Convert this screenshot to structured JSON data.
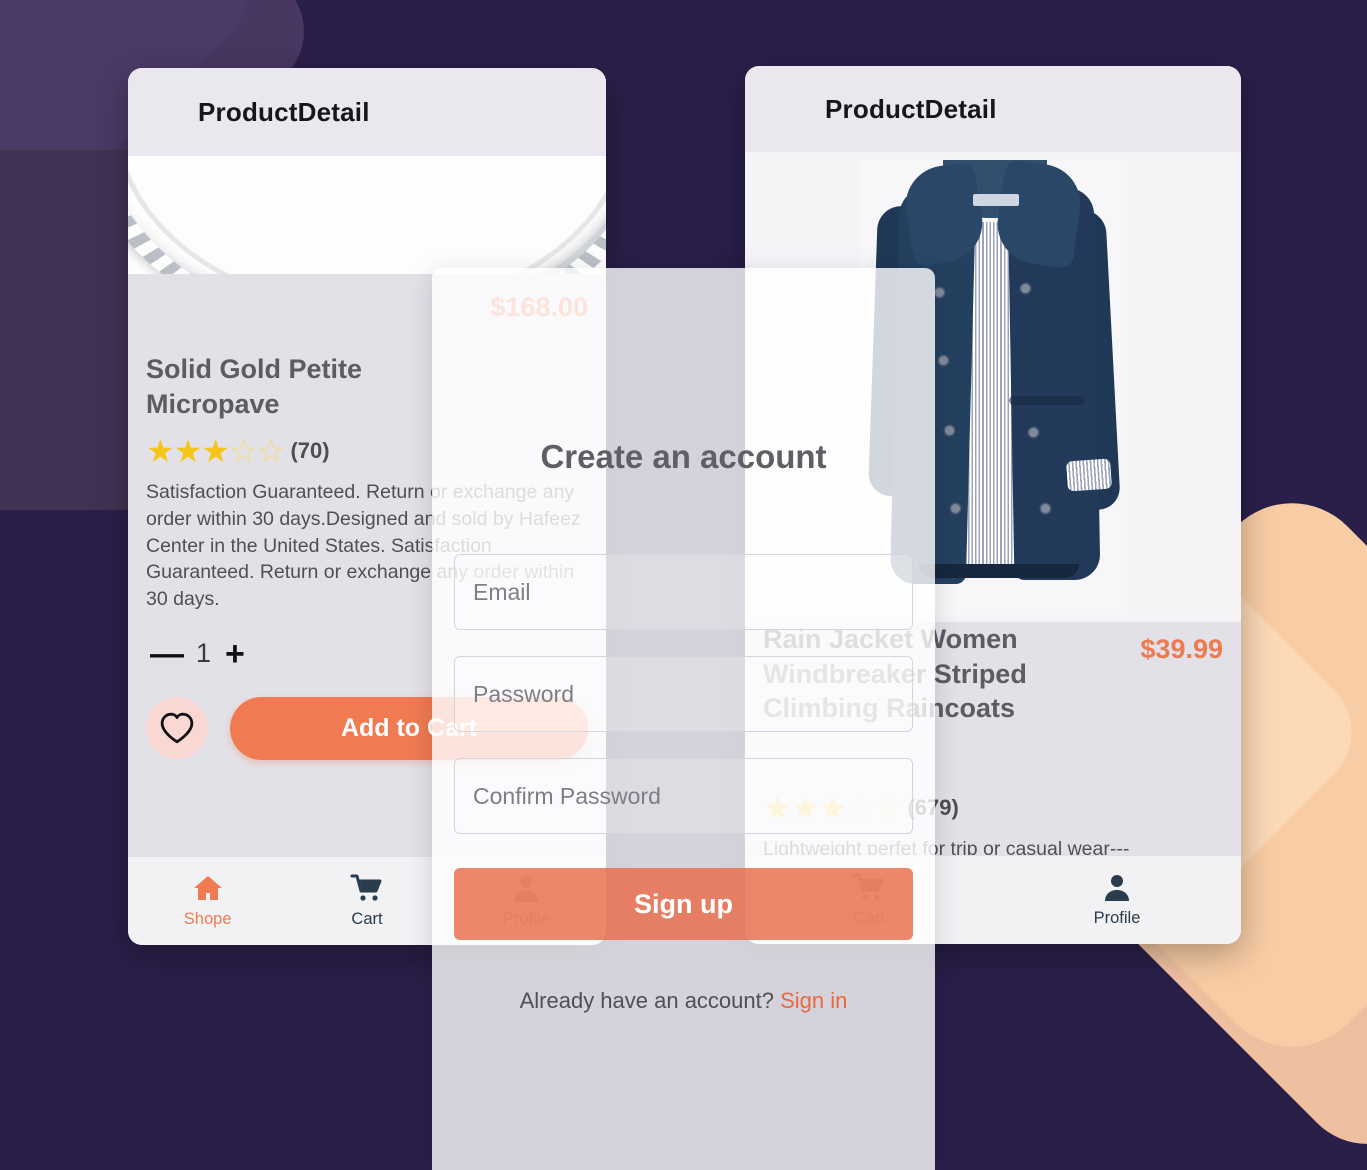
{
  "background": {
    "color": "#2A1F49",
    "accent_peach": "#F8CCA4",
    "accent_purple": "#473761"
  },
  "theme": {
    "orange": "#F07A52",
    "navy": "#24405F",
    "star_gold": "#F5C518"
  },
  "left_phone": {
    "appbar_title": "ProductDetail",
    "product": {
      "price": "$168.00",
      "title": "Solid Gold Petite Micropave",
      "stars_filled": 3,
      "stars_total": 5,
      "stars_glyphs": "★★★",
      "stars_empty_glyphs": "☆☆",
      "rating_count": "(70)",
      "description": "Satisfaction Guaranteed. Return or exchange any order within 30 days.Designed and sold by Hafeez Center in the United States. Satisfaction Guaranteed. Return or exchange any order within 30 days.",
      "quantity": "1",
      "decrement_label": "—",
      "increment_label": "+",
      "add_to_cart_label": "Add to Cart"
    },
    "nav": [
      {
        "label": "Shope",
        "icon": "home-icon",
        "active": true
      },
      {
        "label": "Cart",
        "icon": "cart-icon",
        "active": false
      },
      {
        "label": "Profile",
        "icon": "profile-icon",
        "active": false
      }
    ]
  },
  "right_phone": {
    "appbar_title": "ProductDetail",
    "product": {
      "price": "$39.99",
      "title": "Rain Jacket Women Windbreaker Striped Climbing Raincoats",
      "stars_glyphs": "★★★",
      "stars_empty_glyphs": "☆☆",
      "rating_count": "(679)",
      "description": "Lightweight perfet for trip or casual wear---"
    },
    "nav": [
      {
        "label": "Cart",
        "icon": "cart-icon"
      },
      {
        "label": "Profile",
        "icon": "profile-icon"
      }
    ]
  },
  "modal": {
    "title": "Create an account",
    "email_placeholder": "Email",
    "password_placeholder": "Password",
    "confirm_password_placeholder": "Confirm Password",
    "signup_label": "Sign up",
    "footer_text": "Already have an account?",
    "signin_label": "Sign in"
  }
}
